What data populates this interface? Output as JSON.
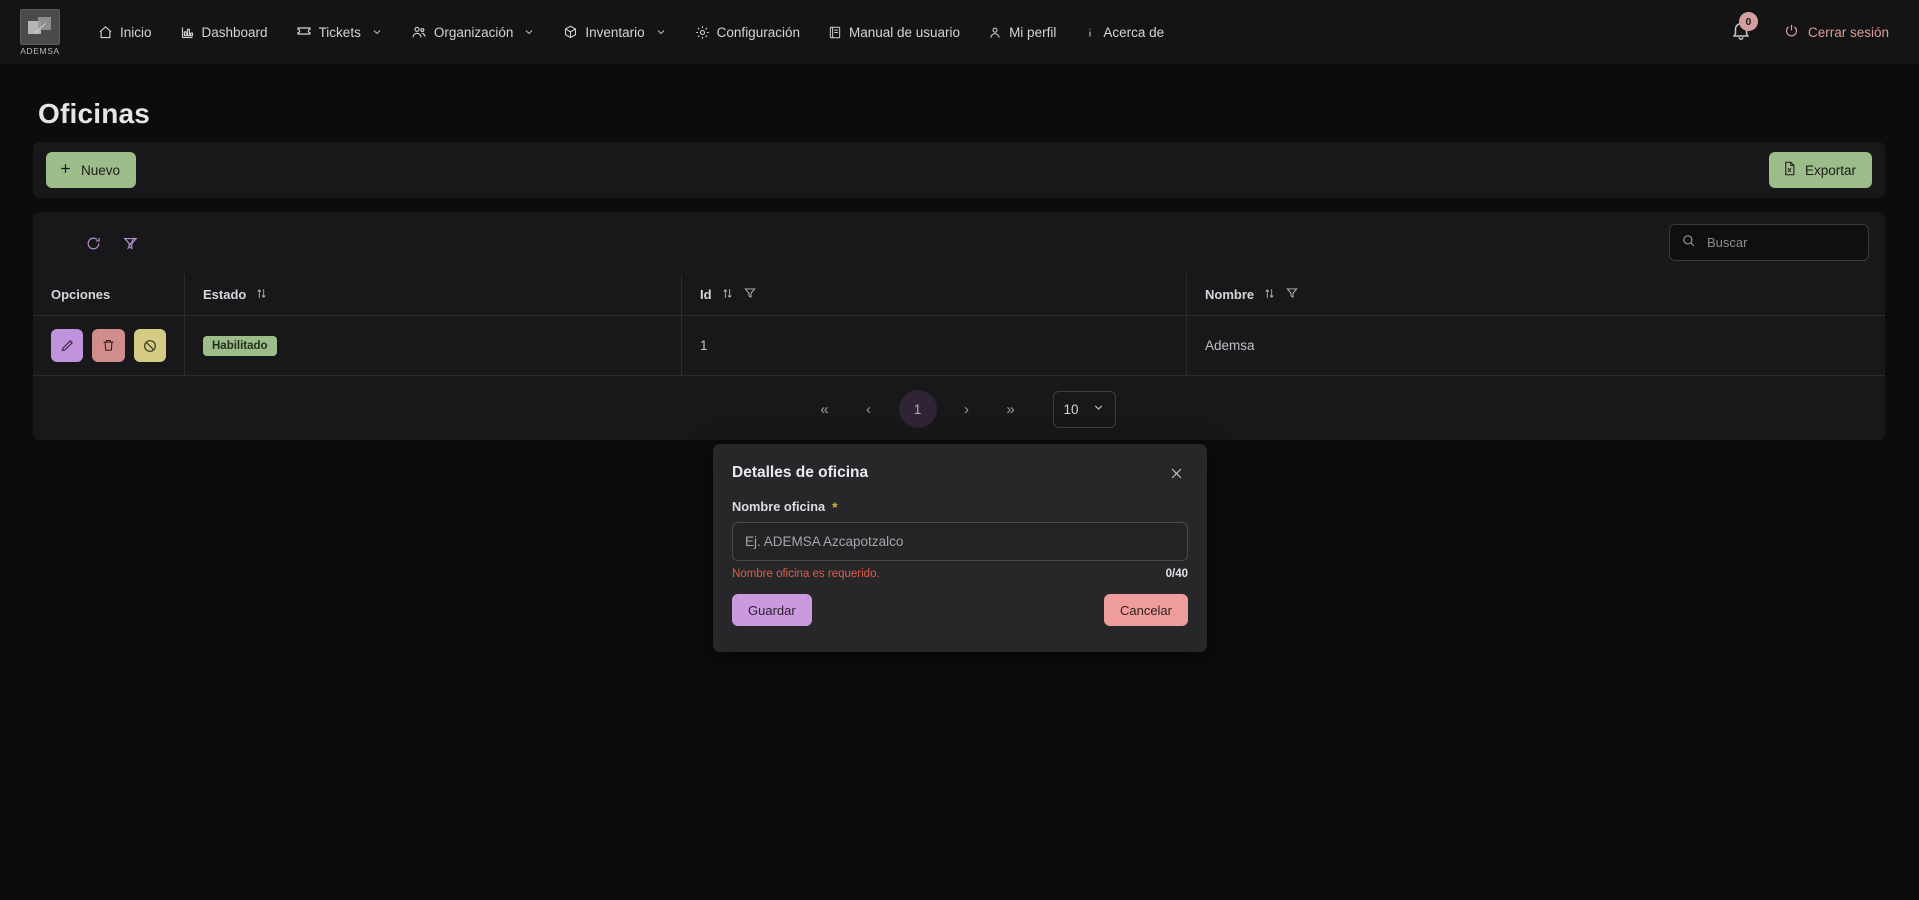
{
  "navbar": {
    "brand": {
      "name": "ADEMSA",
      "icon": "ademsa-logo-icon"
    },
    "items": [
      {
        "label": "Inicio",
        "icon": "home-icon",
        "caret": false
      },
      {
        "label": "Dashboard",
        "icon": "chart-bar-icon",
        "caret": false
      },
      {
        "label": "Tickets",
        "icon": "ticket-icon",
        "caret": true
      },
      {
        "label": "Organización",
        "icon": "users-icon",
        "caret": true
      },
      {
        "label": "Inventario",
        "icon": "box-icon",
        "caret": true
      },
      {
        "label": "Configuración",
        "icon": "gear-icon",
        "caret": false
      },
      {
        "label": "Manual de usuario",
        "icon": "book-icon",
        "caret": false
      },
      {
        "label": "Mi perfil",
        "icon": "user-icon",
        "caret": false
      },
      {
        "label": "Acerca de",
        "icon": "info-icon",
        "caret": false
      }
    ],
    "notifications": {
      "icon": "bell-icon",
      "count": "0"
    },
    "logout": {
      "label": "Cerrar sesión",
      "icon": "power-icon"
    }
  },
  "page": {
    "title": "Oficinas"
  },
  "actions": {
    "new": {
      "label": "Nuevo",
      "icon": "plus-icon"
    },
    "export": {
      "label": "Exportar",
      "icon": "excel-file-icon"
    }
  },
  "table_toolbar": {
    "refresh_icon": "refresh-icon",
    "clear_filter_icon": "filter-slash-icon",
    "search": {
      "placeholder": "Buscar",
      "value": "",
      "icon": "search-icon"
    }
  },
  "table": {
    "columns": [
      {
        "label": "Opciones",
        "sortable": false,
        "filterable": false
      },
      {
        "label": "Estado",
        "sortable": true,
        "filterable": false
      },
      {
        "label": "Id",
        "sortable": true,
        "filterable": true
      },
      {
        "label": "Nombre",
        "sortable": true,
        "filterable": true
      }
    ],
    "row_actions": [
      {
        "name": "edit-button",
        "icon": "pencil-icon"
      },
      {
        "name": "delete-button",
        "icon": "trash-icon"
      },
      {
        "name": "disable-button",
        "icon": "ban-icon"
      }
    ],
    "rows": [
      {
        "estado": "Habilitado",
        "id": "1",
        "nombre": "Ademsa"
      }
    ]
  },
  "pagination": {
    "first": "«",
    "prev": "‹",
    "current_page": "1",
    "next": "›",
    "last": "»",
    "page_size": "10"
  },
  "modal": {
    "title": "Detalles de oficina",
    "close_icon": "close-icon",
    "field_label": "Nombre oficina",
    "required_mark": "*",
    "input_placeholder": "Ej. ADEMSA Azcapotzalco",
    "input_value": "",
    "error": "Nombre oficina es requerido.",
    "counter": "0/40",
    "save_label": "Guardar",
    "cancel_label": "Cancelar"
  },
  "colors": {
    "page_bg": "#0c0c0d",
    "navbar_bg": "#141415",
    "card_bg": "#18181a",
    "modal_bg": "#272729",
    "green_accent": "#9cbc8a",
    "purple_accent": "#cb9ade",
    "salmon_accent": "#ef9c9c",
    "khaki_accent": "#d4cc84",
    "error_red": "#e05b4a",
    "required_gold": "#d6b03c"
  }
}
